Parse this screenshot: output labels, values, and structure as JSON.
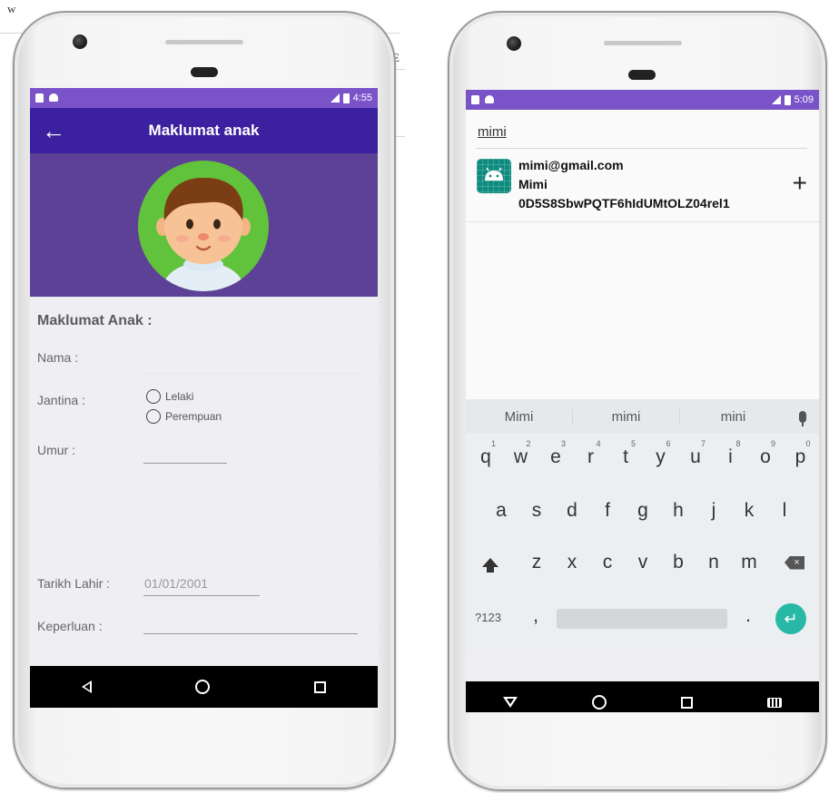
{
  "document_fragments": {
    "top_left": "w",
    "right_edge": "E"
  },
  "colors": {
    "status_bar": "#7a53c9",
    "app_bar": "#3b21a0",
    "header_band": "#5d4197",
    "enter_key": "#27b8a6",
    "app_icon": "#0f8a7e"
  },
  "left_phone": {
    "status": {
      "time": "4:55",
      "left_icons": [
        "sd-card-icon",
        "android-icon"
      ],
      "right_icons": [
        "signal-icon",
        "battery-icon"
      ]
    },
    "app_bar": {
      "back_icon": "arrow-left-icon",
      "title": "Maklumat anak"
    },
    "avatar_icon": "boy-avatar-icon",
    "form": {
      "heading": "Maklumat Anak :",
      "nama_label": "Nama :",
      "nama_value": "",
      "jantina_label": "Jantina :",
      "jantina_options": [
        "Lelaki",
        "Perempuan"
      ],
      "umur_label": "Umur :",
      "umur_value": "",
      "tarikh_label": "Tarikh Lahir :",
      "tarikh_value": "01/01/2001",
      "keperluan_label": "Keperluan :",
      "keperluan_value": ""
    },
    "nav": [
      "back-icon",
      "home-icon",
      "recents-icon"
    ]
  },
  "right_phone": {
    "status": {
      "time": "5:09",
      "left_icons": [
        "sd-card-icon",
        "android-icon"
      ],
      "right_icons": [
        "signal-icon",
        "battery-icon"
      ]
    },
    "search": {
      "value": "mimi"
    },
    "result": {
      "icon": "android-app-icon",
      "email": "mimi@gmail.com",
      "name": "Mimi",
      "uid": "0D5S8SbwPQTF6hIdUMtOLZ04rel1",
      "action_icon": "plus-icon"
    },
    "keyboard": {
      "suggestions": [
        "Mimi",
        "mimi",
        "mini"
      ],
      "row1": [
        "q",
        "w",
        "e",
        "r",
        "t",
        "y",
        "u",
        "i",
        "o",
        "p"
      ],
      "row1_hints": [
        "1",
        "2",
        "3",
        "4",
        "5",
        "6",
        "7",
        "8",
        "9",
        "0"
      ],
      "row2": [
        "a",
        "s",
        "d",
        "f",
        "g",
        "h",
        "j",
        "k",
        "l"
      ],
      "row3": [
        "z",
        "x",
        "c",
        "v",
        "b",
        "n",
        "m"
      ],
      "symbols_label": "?123",
      "comma": ",",
      "period": ".",
      "enter_icon": "enter-icon",
      "shift_icon": "shift-icon",
      "backspace_icon": "backspace-icon",
      "mic_icon": "mic-icon"
    },
    "nav": [
      "hide-keyboard-icon",
      "home-icon",
      "recents-icon",
      "keyboard-switch-icon"
    ]
  }
}
